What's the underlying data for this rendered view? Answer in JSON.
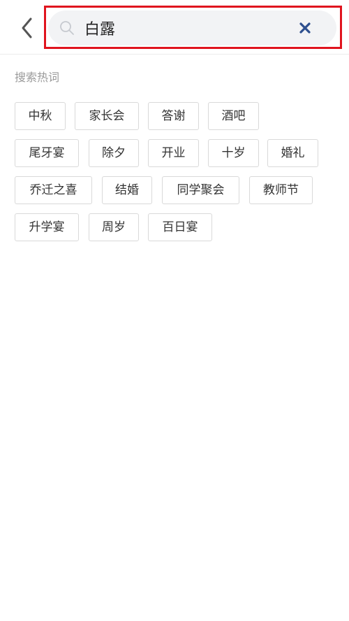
{
  "search": {
    "value": "白露"
  },
  "hot_words": {
    "title": "搜索热词",
    "rows": [
      [
        "中秋",
        "家长会",
        "答谢",
        "酒吧"
      ],
      [
        "尾牙宴",
        "除夕",
        "开业",
        "十岁",
        "婚礼"
      ],
      [
        "乔迁之喜",
        "结婚",
        "同学聚会",
        "教师节"
      ],
      [
        "升学宴",
        "周岁",
        "百日宴"
      ]
    ]
  },
  "colors": {
    "highlight_border": "#e0141e",
    "search_background": "#f2f3f5",
    "clear_icon": "#2d4f8e"
  },
  "icons": {
    "back": "chevron-left-icon",
    "search": "search-icon",
    "clear": "close-icon"
  }
}
